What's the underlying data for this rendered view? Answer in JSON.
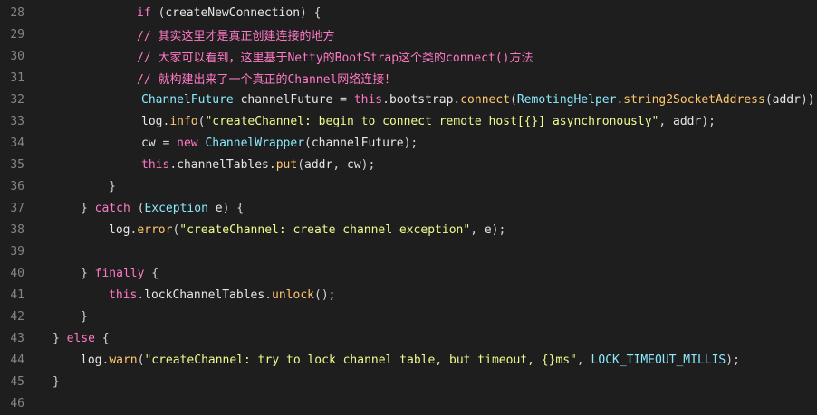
{
  "editor": {
    "lines": [
      {
        "no": "28",
        "tokens": [
          [
            "kw",
            "if"
          ],
          [
            "punc",
            " ("
          ],
          [
            "ident",
            "createNewConnection"
          ],
          [
            "punc",
            ") {"
          ]
        ]
      },
      {
        "no": "29",
        "tokens": [
          [
            "cmt",
            "// 其实这里才是真正创建连接的地方"
          ]
        ]
      },
      {
        "no": "30",
        "tokens": [
          [
            "cmt",
            "// 大家可以看到，这里基于Netty的BootStrap这个类的connect()方法"
          ]
        ]
      },
      {
        "no": "31",
        "tokens": [
          [
            "cmt",
            "// 就构建出来了一个真正的Channel网络连接！"
          ]
        ]
      },
      {
        "no": "32",
        "tokens": [
          [
            "type",
            "ChannelFuture"
          ],
          [
            "punc",
            " "
          ],
          [
            "ident",
            "channelFuture"
          ],
          [
            "punc",
            " = "
          ],
          [
            "kw",
            "this"
          ],
          [
            "punc",
            "."
          ],
          [
            "ident",
            "bootstrap"
          ],
          [
            "punc",
            "."
          ],
          [
            "fn",
            "connect"
          ],
          [
            "punc",
            "("
          ],
          [
            "type",
            "RemotingHelper"
          ],
          [
            "punc",
            "."
          ],
          [
            "fn",
            "string2SocketAddress"
          ],
          [
            "punc",
            "("
          ],
          [
            "ident",
            "addr"
          ],
          [
            "punc",
            "));"
          ]
        ]
      },
      {
        "no": "33",
        "tokens": [
          [
            "ident",
            "log"
          ],
          [
            "punc",
            "."
          ],
          [
            "fn",
            "info"
          ],
          [
            "punc",
            "("
          ],
          [
            "str",
            "\"createChannel: begin to connect remote host[{}] asynchronously\""
          ],
          [
            "punc",
            ", "
          ],
          [
            "ident",
            "addr"
          ],
          [
            "punc",
            ");"
          ]
        ]
      },
      {
        "no": "34",
        "tokens": [
          [
            "ident",
            "cw"
          ],
          [
            "punc",
            " = "
          ],
          [
            "kw",
            "new"
          ],
          [
            "punc",
            " "
          ],
          [
            "type",
            "ChannelWrapper"
          ],
          [
            "punc",
            "("
          ],
          [
            "ident",
            "channelFuture"
          ],
          [
            "punc",
            ");"
          ]
        ]
      },
      {
        "no": "35",
        "tokens": [
          [
            "kw",
            "this"
          ],
          [
            "punc",
            "."
          ],
          [
            "ident",
            "channelTables"
          ],
          [
            "punc",
            "."
          ],
          [
            "fn",
            "put"
          ],
          [
            "punc",
            "("
          ],
          [
            "ident",
            "addr"
          ],
          [
            "punc",
            ", "
          ],
          [
            "ident",
            "cw"
          ],
          [
            "punc",
            ");"
          ]
        ]
      },
      {
        "no": "36",
        "tokens": [
          [
            "punc",
            "}"
          ]
        ]
      },
      {
        "no": "37",
        "tokens": [
          [
            "punc",
            "} "
          ],
          [
            "kw",
            "catch"
          ],
          [
            "punc",
            " ("
          ],
          [
            "type",
            "Exception"
          ],
          [
            "punc",
            " "
          ],
          [
            "ident",
            "e"
          ],
          [
            "punc",
            ") {"
          ]
        ]
      },
      {
        "no": "38",
        "tokens": [
          [
            "ident",
            "log"
          ],
          [
            "punc",
            "."
          ],
          [
            "fn",
            "error"
          ],
          [
            "punc",
            "("
          ],
          [
            "str",
            "\"createChannel: create channel exception\""
          ],
          [
            "punc",
            ", "
          ],
          [
            "ident",
            "e"
          ],
          [
            "punc",
            ");"
          ]
        ]
      },
      {
        "no": "39",
        "tokens": []
      },
      {
        "no": "40",
        "tokens": [
          [
            "punc",
            "} "
          ],
          [
            "kw",
            "finally"
          ],
          [
            "punc",
            " {"
          ]
        ]
      },
      {
        "no": "41",
        "tokens": [
          [
            "kw",
            "this"
          ],
          [
            "punc",
            "."
          ],
          [
            "ident",
            "lockChannelTables"
          ],
          [
            "punc",
            "."
          ],
          [
            "fn",
            "unlock"
          ],
          [
            "punc",
            "();"
          ]
        ]
      },
      {
        "no": "42",
        "tokens": [
          [
            "punc",
            "}"
          ]
        ]
      },
      {
        "no": "43",
        "tokens": [
          [
            "punc",
            "} "
          ],
          [
            "kw",
            "else"
          ],
          [
            "punc",
            " {"
          ]
        ]
      },
      {
        "no": "44",
        "tokens": [
          [
            "ident",
            "log"
          ],
          [
            "punc",
            "."
          ],
          [
            "fn",
            "warn"
          ],
          [
            "punc",
            "("
          ],
          [
            "str",
            "\"createChannel: try to lock channel table, but timeout, {}ms\""
          ],
          [
            "punc",
            ", "
          ],
          [
            "type",
            "LOCK_TIMEOUT_MILLIS"
          ],
          [
            "punc",
            ");"
          ]
        ]
      },
      {
        "no": "45",
        "tokens": [
          [
            "punc",
            "}"
          ]
        ]
      },
      {
        "no": "46",
        "tokens": []
      }
    ]
  },
  "colors": {
    "background": "#1e1e1e",
    "line_number": "#858585",
    "keyword": "#ff79c6",
    "function": "#ffc66d",
    "string": "#f1fa8c",
    "type": "#8be9fd",
    "text": "#e6e6e6"
  }
}
